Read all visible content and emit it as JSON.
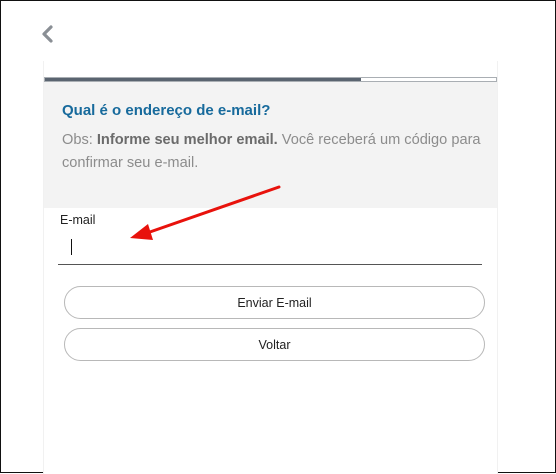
{
  "nav": {
    "back_icon": "chevron-left-icon"
  },
  "progress": {
    "fraction": 0.7
  },
  "form": {
    "question": "Qual é o endereço de e-mail?",
    "obs_prefix": "Obs: ",
    "obs_bold": "Informe seu melhor email.",
    "obs_rest": " Você receberá um código para confirmar seu e-mail.",
    "email_label": "E-mail",
    "email_value": "",
    "email_placeholder": ""
  },
  "buttons": {
    "send_label": "Enviar E-mail",
    "back_label": "Voltar"
  },
  "annotation": {
    "arrow_color": "#e8120c",
    "target": "email-input"
  },
  "colors": {
    "accent": "#176a9c",
    "progress_fill": "#5a6470",
    "header_bg": "#f3f3f3"
  }
}
